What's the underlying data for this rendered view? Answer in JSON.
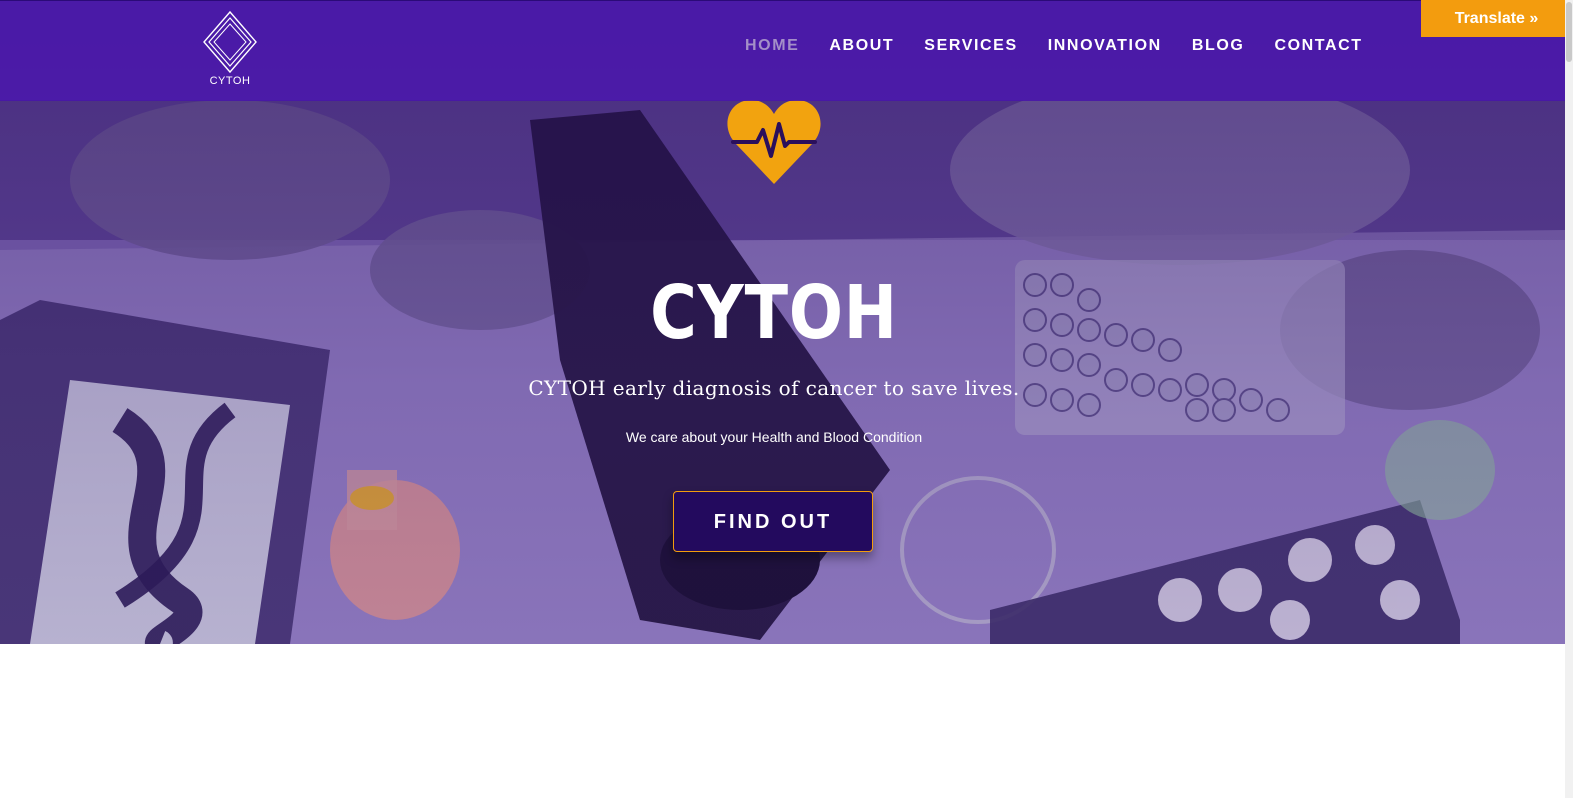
{
  "brand": {
    "name": "CYTOH"
  },
  "nav": {
    "items": [
      {
        "label": "HOME",
        "active": true
      },
      {
        "label": "ABOUT",
        "active": false
      },
      {
        "label": "SERVICES",
        "active": false
      },
      {
        "label": "INNOVATION",
        "active": false
      },
      {
        "label": "BLOG",
        "active": false
      },
      {
        "label": "CONTACT",
        "active": false
      }
    ]
  },
  "translate": {
    "label": "Translate »"
  },
  "hero": {
    "icon": "heart-pulse-icon",
    "title": "CYTOH",
    "subtitle": "CYTOH early diagnosis of cancer to save lives.",
    "tagline": "We care about your Health and Blood Condition",
    "cta_label": "FIND OUT"
  },
  "colors": {
    "header_bg": "#4814aa",
    "accent": "#f39c0e",
    "cta_bg": "#230a5e",
    "nav_active": "#a48fc8"
  }
}
